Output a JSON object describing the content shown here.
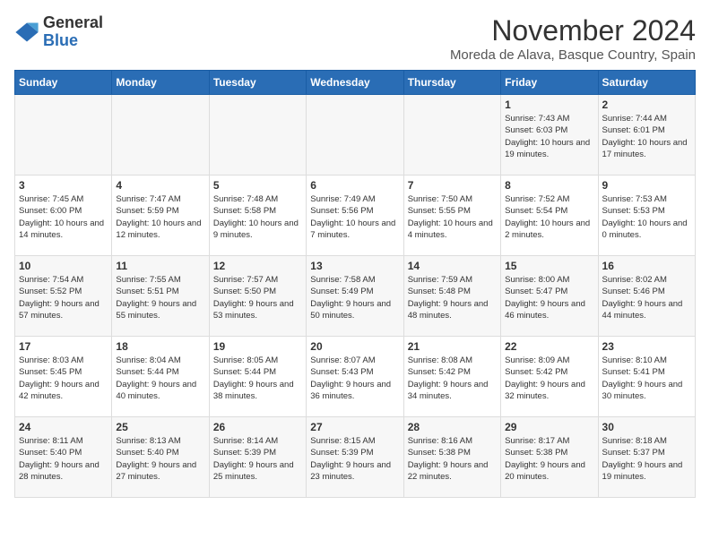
{
  "logo": {
    "general": "General",
    "blue": "Blue"
  },
  "header": {
    "title": "November 2024",
    "subtitle": "Moreda de Alava, Basque Country, Spain"
  },
  "weekdays": [
    "Sunday",
    "Monday",
    "Tuesday",
    "Wednesday",
    "Thursday",
    "Friday",
    "Saturday"
  ],
  "weeks": [
    [
      {
        "day": "",
        "info": ""
      },
      {
        "day": "",
        "info": ""
      },
      {
        "day": "",
        "info": ""
      },
      {
        "day": "",
        "info": ""
      },
      {
        "day": "",
        "info": ""
      },
      {
        "day": "1",
        "info": "Sunrise: 7:43 AM\nSunset: 6:03 PM\nDaylight: 10 hours and 19 minutes."
      },
      {
        "day": "2",
        "info": "Sunrise: 7:44 AM\nSunset: 6:01 PM\nDaylight: 10 hours and 17 minutes."
      }
    ],
    [
      {
        "day": "3",
        "info": "Sunrise: 7:45 AM\nSunset: 6:00 PM\nDaylight: 10 hours and 14 minutes."
      },
      {
        "day": "4",
        "info": "Sunrise: 7:47 AM\nSunset: 5:59 PM\nDaylight: 10 hours and 12 minutes."
      },
      {
        "day": "5",
        "info": "Sunrise: 7:48 AM\nSunset: 5:58 PM\nDaylight: 10 hours and 9 minutes."
      },
      {
        "day": "6",
        "info": "Sunrise: 7:49 AM\nSunset: 5:56 PM\nDaylight: 10 hours and 7 minutes."
      },
      {
        "day": "7",
        "info": "Sunrise: 7:50 AM\nSunset: 5:55 PM\nDaylight: 10 hours and 4 minutes."
      },
      {
        "day": "8",
        "info": "Sunrise: 7:52 AM\nSunset: 5:54 PM\nDaylight: 10 hours and 2 minutes."
      },
      {
        "day": "9",
        "info": "Sunrise: 7:53 AM\nSunset: 5:53 PM\nDaylight: 10 hours and 0 minutes."
      }
    ],
    [
      {
        "day": "10",
        "info": "Sunrise: 7:54 AM\nSunset: 5:52 PM\nDaylight: 9 hours and 57 minutes."
      },
      {
        "day": "11",
        "info": "Sunrise: 7:55 AM\nSunset: 5:51 PM\nDaylight: 9 hours and 55 minutes."
      },
      {
        "day": "12",
        "info": "Sunrise: 7:57 AM\nSunset: 5:50 PM\nDaylight: 9 hours and 53 minutes."
      },
      {
        "day": "13",
        "info": "Sunrise: 7:58 AM\nSunset: 5:49 PM\nDaylight: 9 hours and 50 minutes."
      },
      {
        "day": "14",
        "info": "Sunrise: 7:59 AM\nSunset: 5:48 PM\nDaylight: 9 hours and 48 minutes."
      },
      {
        "day": "15",
        "info": "Sunrise: 8:00 AM\nSunset: 5:47 PM\nDaylight: 9 hours and 46 minutes."
      },
      {
        "day": "16",
        "info": "Sunrise: 8:02 AM\nSunset: 5:46 PM\nDaylight: 9 hours and 44 minutes."
      }
    ],
    [
      {
        "day": "17",
        "info": "Sunrise: 8:03 AM\nSunset: 5:45 PM\nDaylight: 9 hours and 42 minutes."
      },
      {
        "day": "18",
        "info": "Sunrise: 8:04 AM\nSunset: 5:44 PM\nDaylight: 9 hours and 40 minutes."
      },
      {
        "day": "19",
        "info": "Sunrise: 8:05 AM\nSunset: 5:44 PM\nDaylight: 9 hours and 38 minutes."
      },
      {
        "day": "20",
        "info": "Sunrise: 8:07 AM\nSunset: 5:43 PM\nDaylight: 9 hours and 36 minutes."
      },
      {
        "day": "21",
        "info": "Sunrise: 8:08 AM\nSunset: 5:42 PM\nDaylight: 9 hours and 34 minutes."
      },
      {
        "day": "22",
        "info": "Sunrise: 8:09 AM\nSunset: 5:42 PM\nDaylight: 9 hours and 32 minutes."
      },
      {
        "day": "23",
        "info": "Sunrise: 8:10 AM\nSunset: 5:41 PM\nDaylight: 9 hours and 30 minutes."
      }
    ],
    [
      {
        "day": "24",
        "info": "Sunrise: 8:11 AM\nSunset: 5:40 PM\nDaylight: 9 hours and 28 minutes."
      },
      {
        "day": "25",
        "info": "Sunrise: 8:13 AM\nSunset: 5:40 PM\nDaylight: 9 hours and 27 minutes."
      },
      {
        "day": "26",
        "info": "Sunrise: 8:14 AM\nSunset: 5:39 PM\nDaylight: 9 hours and 25 minutes."
      },
      {
        "day": "27",
        "info": "Sunrise: 8:15 AM\nSunset: 5:39 PM\nDaylight: 9 hours and 23 minutes."
      },
      {
        "day": "28",
        "info": "Sunrise: 8:16 AM\nSunset: 5:38 PM\nDaylight: 9 hours and 22 minutes."
      },
      {
        "day": "29",
        "info": "Sunrise: 8:17 AM\nSunset: 5:38 PM\nDaylight: 9 hours and 20 minutes."
      },
      {
        "day": "30",
        "info": "Sunrise: 8:18 AM\nSunset: 5:37 PM\nDaylight: 9 hours and 19 minutes."
      }
    ]
  ]
}
